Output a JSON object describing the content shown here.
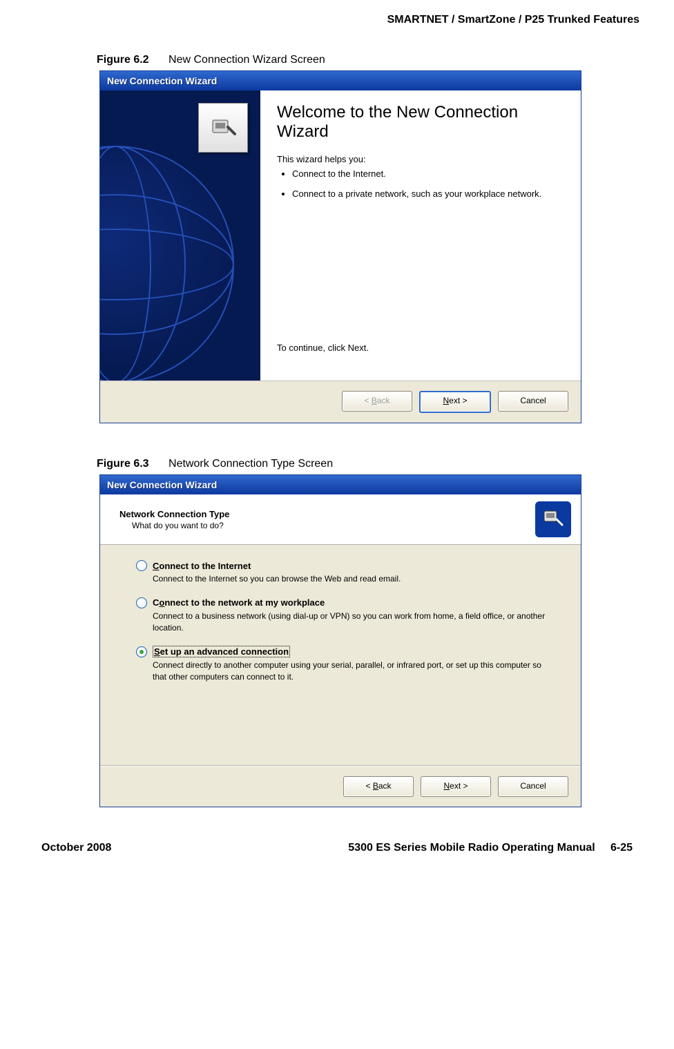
{
  "header": "SMARTNET / SmartZone / P25 Trunked Features",
  "fig1": {
    "num": "Figure 6.2",
    "title": "New Connection Wizard Screen",
    "dialog_title": "New Connection Wizard",
    "heading": "Welcome to the New Connection Wizard",
    "intro": "This wizard helps you:",
    "bullet1": "Connect to the Internet.",
    "bullet2": "Connect to a private network, such as your workplace network.",
    "continue": "To continue, click Next.",
    "back": "< Back",
    "next": "Next >",
    "cancel": "Cancel"
  },
  "fig2": {
    "num": "Figure 6.3",
    "title": "Network Connection Type Screen",
    "dialog_title": "New Connection Wizard",
    "header_title": "Network Connection Type",
    "header_sub": "What do you want to do?",
    "opt1_label": "Connect to the Internet",
    "opt1_desc": "Connect to the Internet so you can browse the Web and read email.",
    "opt2_label": "Connect to the network at my workplace",
    "opt2_desc": "Connect to a business network (using dial-up or VPN) so you can work from home, a field office, or another location.",
    "opt3_label": "Set up an advanced connection",
    "opt3_desc": "Connect directly to another computer using your serial, parallel, or infrared port, or set up this computer so that other computers can connect to it.",
    "back": "< Back",
    "next": "Next >",
    "cancel": "Cancel"
  },
  "footer": {
    "left": "October 2008",
    "center": "5300 ES Series Mobile Radio Operating Manual",
    "right": "6-25"
  }
}
